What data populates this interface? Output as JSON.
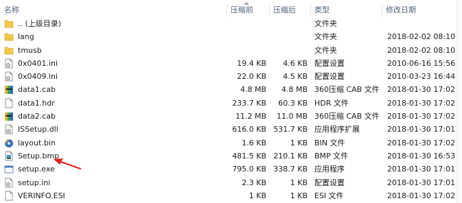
{
  "columns": {
    "name": "名称",
    "compressed": "压缩前",
    "original": "压缩后",
    "type": "类型",
    "modified": "修改日期"
  },
  "files": [
    {
      "icon": "folder-up-icon",
      "name": ".. (上级目录)",
      "size1": "",
      "size2": "",
      "type": "文件夹",
      "date": ""
    },
    {
      "icon": "folder-icon",
      "name": "lang",
      "size1": "",
      "size2": "",
      "type": "文件夹",
      "date": "2018-02-02 08:10"
    },
    {
      "icon": "folder-icon",
      "name": "tmusb",
      "size1": "",
      "size2": "",
      "type": "文件夹",
      "date": "2018-02-02 08:10"
    },
    {
      "icon": "ini-file-icon",
      "name": "0x0401.ini",
      "size1": "19.4 KB",
      "size2": "4.6 KB",
      "type": "配置设置",
      "date": "2010-06-16 15:56"
    },
    {
      "icon": "ini-file-icon",
      "name": "0x0409.ini",
      "size1": "22.0 KB",
      "size2": "4.5 KB",
      "type": "配置设置",
      "date": "2010-03-23 16:44"
    },
    {
      "icon": "cab-file-icon",
      "name": "data1.cab",
      "size1": "4.8 MB",
      "size2": "4.8 MB",
      "type": "360压缩 CAB 文件",
      "date": "2018-01-30 17:02"
    },
    {
      "icon": "blank-file-icon",
      "name": "data1.hdr",
      "size1": "233.7 KB",
      "size2": "60.3 KB",
      "type": "HDR 文件",
      "date": "2018-01-30 17:02"
    },
    {
      "icon": "cab-file-icon",
      "name": "data2.cab",
      "size1": "11.2 MB",
      "size2": "11.0 MB",
      "type": "360压缩 CAB 文件",
      "date": "2018-01-30 17:02"
    },
    {
      "icon": "dll-file-icon",
      "name": "ISSetup.dll",
      "size1": "616.0 KB",
      "size2": "531.7 KB",
      "type": "应用程序扩展",
      "date": "2018-01-30 17:01"
    },
    {
      "icon": "bin-file-icon",
      "name": "layout.bin",
      "size1": "1.6 KB",
      "size2": "1 KB",
      "type": "BIN 文件",
      "date": "2018-01-30 17:02"
    },
    {
      "icon": "bmp-file-icon",
      "name": "Setup.bmp",
      "size1": "481.5 KB",
      "size2": "210.1 KB",
      "type": "BMP 文件",
      "date": "2018-01-30 16:53"
    },
    {
      "icon": "exe-file-icon",
      "name": "setup.exe",
      "size1": "795.0 KB",
      "size2": "338.7 KB",
      "type": "应用程序",
      "date": "2018-01-30 17:01"
    },
    {
      "icon": "ini-file-icon",
      "name": "setup.ini",
      "size1": "2.3 KB",
      "size2": "1 KB",
      "type": "配置设置",
      "date": "2018-01-30 17:01"
    },
    {
      "icon": "blank-file-icon",
      "name": "VERINFO.ESI",
      "size1": "1 KB",
      "size2": "1 KB",
      "type": "ESI 文件",
      "date": "2018-01-30 17:02"
    }
  ],
  "annotation": {
    "icon": "red-arrow-icon",
    "target": "setup.exe",
    "color": "#e0201c"
  },
  "colors": {
    "header_text": "#4c607a",
    "folder": "#f2c94c"
  }
}
